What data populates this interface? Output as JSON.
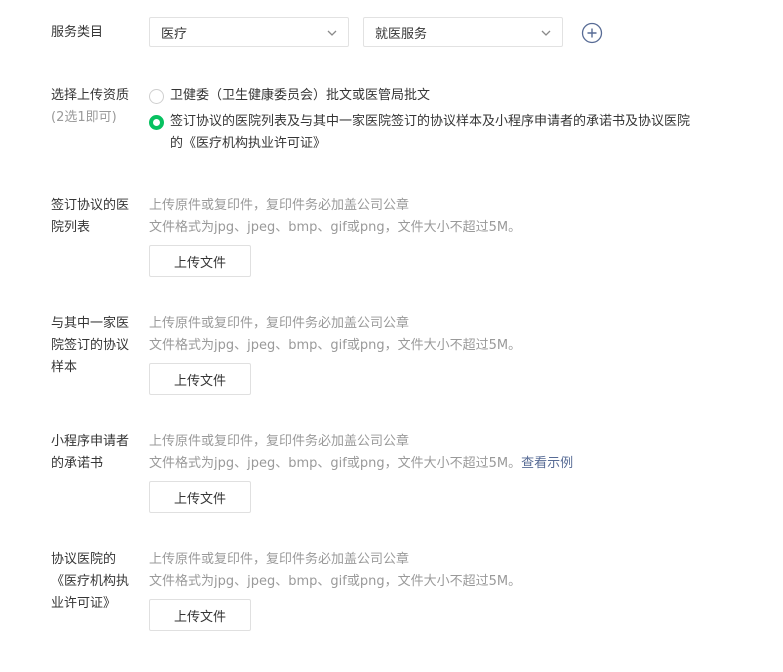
{
  "service": {
    "label": "服务类目",
    "category1": "医疗",
    "category2": "就医服务"
  },
  "qualification": {
    "label": "选择上传资质",
    "sublabel": "(2选1即可)",
    "option1": "卫健委（卫生健康委员会）批文或医管局批文",
    "option2": "签订协议的医院列表及与其中一家医院签订的协议样本及小程序申请者的承诺书及协议医院的《医疗机构执业许可证》"
  },
  "uploads": [
    {
      "label": "签订协议的医院列表",
      "hint1": "上传原件或复印件，复印件务必加盖公司公章",
      "hint2": "文件格式为jpg、jpeg、bmp、gif或png，文件大小不超过5M。",
      "link": "",
      "button": "上传文件"
    },
    {
      "label": "与其中一家医院签订的协议样本",
      "hint1": "上传原件或复印件，复印件务必加盖公司公章",
      "hint2": "文件格式为jpg、jpeg、bmp、gif或png，文件大小不超过5M。",
      "link": "",
      "button": "上传文件"
    },
    {
      "label": "小程序申请者的承诺书",
      "hint1": "上传原件或复印件，复印件务必加盖公司公章",
      "hint2": "文件格式为jpg、jpeg、bmp、gif或png，文件大小不超过5M。",
      "link": "查看示例",
      "button": "上传文件"
    },
    {
      "label": "协议医院的《医疗机构执业许可证》",
      "hint1": "上传原件或复印件，复印件务必加盖公司公章",
      "hint2": "文件格式为jpg、jpeg、bmp、gif或png，文件大小不超过5M。",
      "link": "",
      "button": "上传文件"
    }
  ]
}
